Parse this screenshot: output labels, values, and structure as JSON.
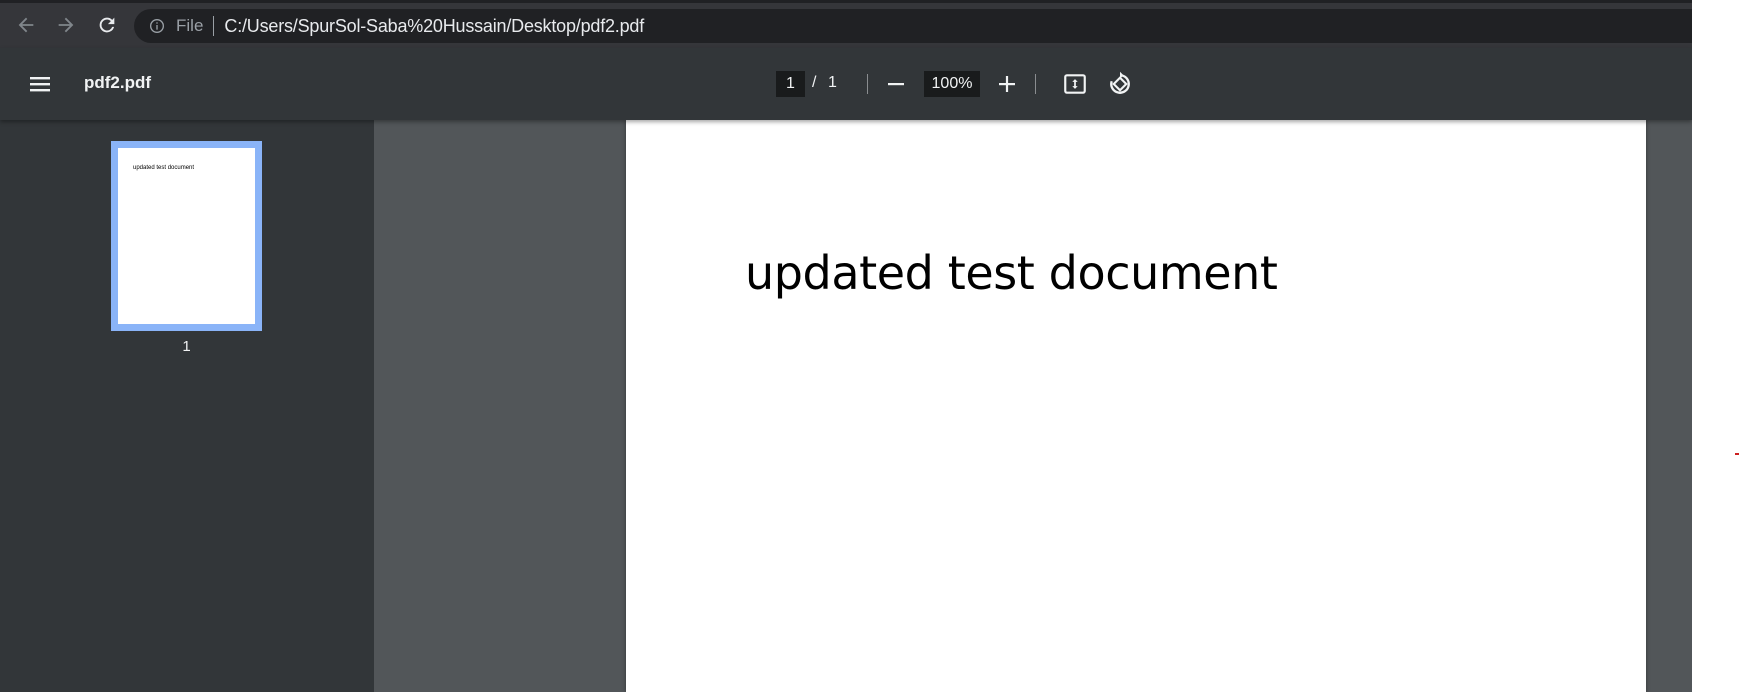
{
  "browser": {
    "scheme_label": "File",
    "url": "C:/Users/SpurSol-Saba%20Hussain/Desktop/pdf2.pdf"
  },
  "toolbar": {
    "title": "pdf2.pdf",
    "current_page": "1",
    "page_separator": "/",
    "total_pages": "1",
    "zoom": "100%"
  },
  "sidebar": {
    "thumbnails": [
      {
        "page_number": "1",
        "preview_text": "updated test document"
      }
    ]
  },
  "document": {
    "text": "updated test document"
  },
  "colors": {
    "thumbnail_selected_border": "#8ab4f8",
    "toolbar_bg": "#323639",
    "viewer_bg": "#525659"
  },
  "icons": [
    "back-arrow-icon",
    "forward-arrow-icon",
    "reload-icon",
    "info-icon",
    "menu-icon",
    "minus-icon",
    "plus-icon",
    "fit-to-page-icon",
    "rotate-icon"
  ]
}
